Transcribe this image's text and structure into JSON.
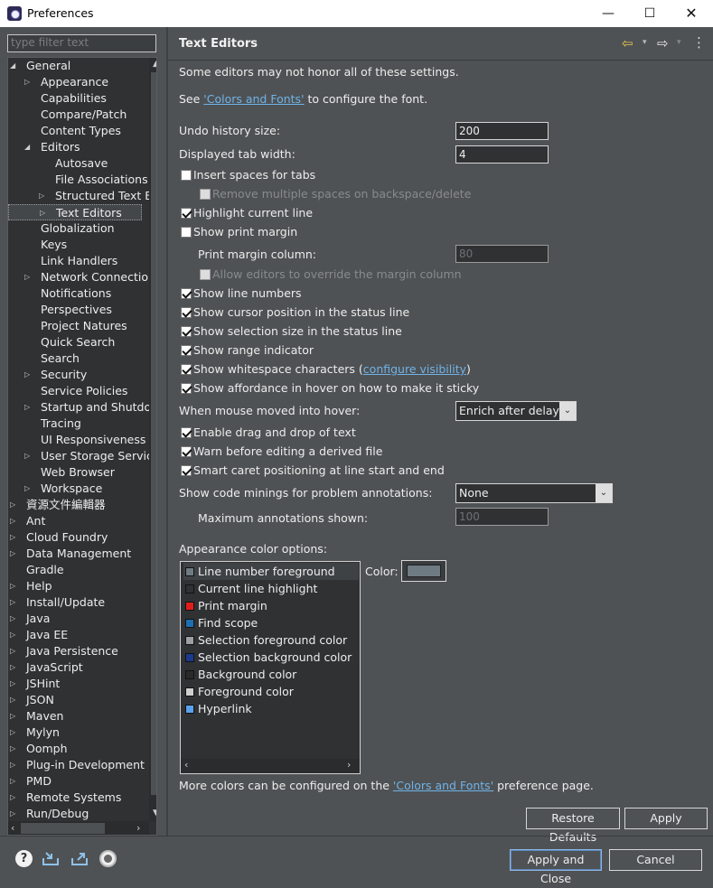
{
  "window": {
    "title": "Preferences",
    "minimize_glyph": "—",
    "maximize_glyph": "☐",
    "close_glyph": "✕"
  },
  "sidebar": {
    "filter_placeholder": "type filter text",
    "items": [
      {
        "label": "General",
        "depth": 0,
        "twisty": "open"
      },
      {
        "label": "Appearance",
        "depth": 1,
        "twisty": "closed"
      },
      {
        "label": "Capabilities",
        "depth": 1,
        "twisty": "none"
      },
      {
        "label": "Compare/Patch",
        "depth": 1,
        "twisty": "none"
      },
      {
        "label": "Content Types",
        "depth": 1,
        "twisty": "none"
      },
      {
        "label": "Editors",
        "depth": 1,
        "twisty": "open"
      },
      {
        "label": "Autosave",
        "depth": 2,
        "twisty": "none"
      },
      {
        "label": "File Associations",
        "depth": 2,
        "twisty": "none"
      },
      {
        "label": "Structured Text E",
        "depth": 2,
        "twisty": "closed"
      },
      {
        "label": "Text Editors",
        "depth": 2,
        "twisty": "closed",
        "selected": true
      },
      {
        "label": "Globalization",
        "depth": 1,
        "twisty": "none"
      },
      {
        "label": "Keys",
        "depth": 1,
        "twisty": "none"
      },
      {
        "label": "Link Handlers",
        "depth": 1,
        "twisty": "none"
      },
      {
        "label": "Network Connection",
        "depth": 1,
        "twisty": "closed"
      },
      {
        "label": "Notifications",
        "depth": 1,
        "twisty": "none"
      },
      {
        "label": "Perspectives",
        "depth": 1,
        "twisty": "none"
      },
      {
        "label": "Project Natures",
        "depth": 1,
        "twisty": "none"
      },
      {
        "label": "Quick Search",
        "depth": 1,
        "twisty": "none"
      },
      {
        "label": "Search",
        "depth": 1,
        "twisty": "none"
      },
      {
        "label": "Security",
        "depth": 1,
        "twisty": "closed"
      },
      {
        "label": "Service Policies",
        "depth": 1,
        "twisty": "none"
      },
      {
        "label": "Startup and Shutdo",
        "depth": 1,
        "twisty": "closed"
      },
      {
        "label": "Tracing",
        "depth": 1,
        "twisty": "none"
      },
      {
        "label": "UI Responsiveness M",
        "depth": 1,
        "twisty": "none"
      },
      {
        "label": "User Storage Service",
        "depth": 1,
        "twisty": "closed"
      },
      {
        "label": "Web Browser",
        "depth": 1,
        "twisty": "none"
      },
      {
        "label": "Workspace",
        "depth": 1,
        "twisty": "closed"
      },
      {
        "label": "資源文件編輯器",
        "depth": 0,
        "twisty": "closed"
      },
      {
        "label": "Ant",
        "depth": 0,
        "twisty": "closed"
      },
      {
        "label": "Cloud Foundry",
        "depth": 0,
        "twisty": "closed"
      },
      {
        "label": "Data Management",
        "depth": 0,
        "twisty": "closed"
      },
      {
        "label": "Gradle",
        "depth": 0,
        "twisty": "none"
      },
      {
        "label": "Help",
        "depth": 0,
        "twisty": "closed"
      },
      {
        "label": "Install/Update",
        "depth": 0,
        "twisty": "closed"
      },
      {
        "label": "Java",
        "depth": 0,
        "twisty": "closed"
      },
      {
        "label": "Java EE",
        "depth": 0,
        "twisty": "closed"
      },
      {
        "label": "Java Persistence",
        "depth": 0,
        "twisty": "closed"
      },
      {
        "label": "JavaScript",
        "depth": 0,
        "twisty": "closed"
      },
      {
        "label": "JSHint",
        "depth": 0,
        "twisty": "closed"
      },
      {
        "label": "JSON",
        "depth": 0,
        "twisty": "closed"
      },
      {
        "label": "Maven",
        "depth": 0,
        "twisty": "closed"
      },
      {
        "label": "Mylyn",
        "depth": 0,
        "twisty": "closed"
      },
      {
        "label": "Oomph",
        "depth": 0,
        "twisty": "closed"
      },
      {
        "label": "Plug-in Development",
        "depth": 0,
        "twisty": "closed"
      },
      {
        "label": "PMD",
        "depth": 0,
        "twisty": "closed"
      },
      {
        "label": "Remote Systems",
        "depth": 0,
        "twisty": "closed"
      },
      {
        "label": "Run/Debug",
        "depth": 0,
        "twisty": "closed"
      }
    ]
  },
  "page": {
    "title": "Text Editors",
    "note": "Some editors may not honor all of these settings.",
    "see_prefix": "See ",
    "colors_fonts_link": "'Colors and Fonts'",
    "see_suffix": " to configure the font.",
    "undo_label": "Undo history size:",
    "undo_value": "200",
    "tab_width_label": "Displayed tab width:",
    "tab_width_value": "4",
    "insert_spaces": {
      "label": "Insert spaces for tabs",
      "checked": false
    },
    "remove_spaces": {
      "label": "Remove multiple spaces on backspace/delete",
      "checked": false,
      "disabled": true
    },
    "highlight_line": {
      "label": "Highlight current line",
      "checked": true
    },
    "show_print_margin": {
      "label": "Show print margin",
      "checked": false
    },
    "print_margin_label": "Print margin column:",
    "print_margin_value": "80",
    "allow_override": {
      "label": "Allow editors to override the margin column",
      "checked": false,
      "disabled": true
    },
    "show_line_numbers": {
      "label": "Show line numbers",
      "checked": true
    },
    "show_cursor_pos": {
      "label": "Show cursor position in the status line",
      "checked": true
    },
    "show_selection_size": {
      "label": "Show selection size in the status line",
      "checked": true
    },
    "show_range": {
      "label": "Show range indicator",
      "checked": true
    },
    "show_whitespace": {
      "label": "Show whitespace characters",
      "checked": true
    },
    "ws_paren_open": " (",
    "configure_visibility_link": "configure visibility",
    "ws_paren_close": ")",
    "show_affordance": {
      "label": "Show affordance in hover on how to make it sticky",
      "checked": true
    },
    "hover_label": "When mouse moved into hover:",
    "hover_value": "Enrich after delay",
    "drag_drop": {
      "label": "Enable drag and drop of text",
      "checked": true
    },
    "warn_derived": {
      "label": "Warn before editing a derived file",
      "checked": true
    },
    "smart_caret": {
      "label": "Smart caret positioning at line start and end",
      "checked": true
    },
    "code_minings_label": "Show code minings for problem annotations:",
    "code_minings_value": "None",
    "max_annotations_label": "Maximum annotations shown:",
    "max_annotations_value": "100",
    "appearance_label": "Appearance color options:",
    "color_label": "Color:",
    "current_color": "#6e7b83",
    "color_items": [
      {
        "label": "Line number foreground",
        "color": "#6e7b83",
        "selected": true
      },
      {
        "label": "Current line highlight",
        "color": "#2f3133"
      },
      {
        "label": "Print margin",
        "color": "#e01d1d"
      },
      {
        "label": "Find scope",
        "color": "#1f6fb0"
      },
      {
        "label": "Selection foreground color",
        "color": "#9aa0a3"
      },
      {
        "label": "Selection background color",
        "color": "#1c3a8c"
      },
      {
        "label": "Background color",
        "color": "#2a2a2a"
      },
      {
        "label": "Foreground color",
        "color": "#cfcfcf"
      },
      {
        "label": "Hyperlink",
        "color": "#5aa2f0"
      }
    ],
    "more_prefix": "More colors can be configured on the ",
    "more_link": "'Colors and Fonts'",
    "more_suffix": " preference page."
  },
  "buttons": {
    "restore_defaults": "Restore Defaults",
    "apply": "Apply",
    "apply_close": "Apply and Close",
    "cancel": "Cancel"
  },
  "icons": {
    "help": "help-icon",
    "import": "import-icon",
    "export": "export-icon",
    "record": "record-icon",
    "back": "back-arrow-icon",
    "forward": "forward-arrow-icon",
    "menu": "view-menu-icon"
  }
}
